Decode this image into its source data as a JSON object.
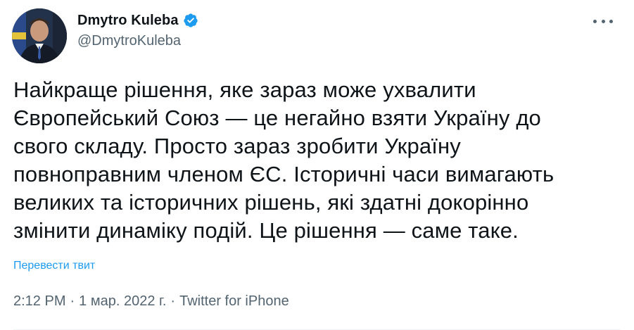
{
  "author": {
    "display_name": "Dmytro Kuleba",
    "handle": "@DmytroKuleba",
    "verified": true,
    "avatar_icon": "person-avatar"
  },
  "tweet": {
    "text": "Найкраще рішення, яке зараз може ухвалити\nЄвропейський Союз — це негайно взяти Україну до\nсвого складу. Просто зараз зробити Україну\nповноправним членом ЄС. Історичні часи вимагають\nвеликих та історичних рішень, які здатні докорінно\nзмінити динаміку подій. Це рішення — саме таке.",
    "translate_label": "Перевести твит",
    "time": "2:12 PM",
    "date": "1 мар. 2022 г.",
    "source": "Twitter for iPhone",
    "separator": "·"
  },
  "colors": {
    "text": "#0f1419",
    "secondary": "#536471",
    "accent": "#1d9bf0"
  },
  "icons": {
    "more": "more-horizontal-icon",
    "verified": "verified-badge-icon"
  }
}
